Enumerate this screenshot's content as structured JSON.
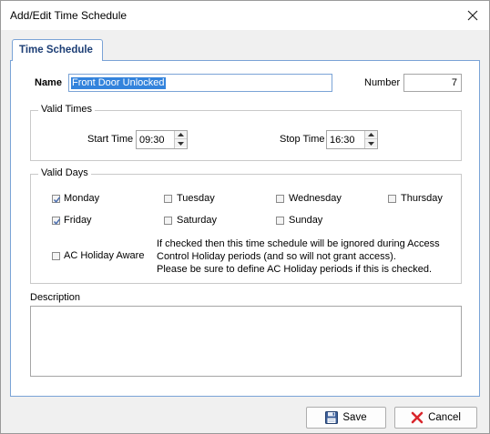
{
  "window": {
    "title": "Add/Edit Time Schedule"
  },
  "tab": {
    "label": "Time Schedule"
  },
  "form": {
    "name_label": "Name",
    "name_value": "Front Door Unlocked",
    "number_label": "Number",
    "number_value": "7"
  },
  "valid_times": {
    "title": "Valid Times",
    "start_label": "Start Time",
    "start_value": "09:30",
    "stop_label": "Stop Time",
    "stop_value": "16:30"
  },
  "valid_days": {
    "title": "Valid Days",
    "days": [
      {
        "label": "Monday",
        "checked": true
      },
      {
        "label": "Tuesday",
        "checked": false
      },
      {
        "label": "Wednesday",
        "checked": false
      },
      {
        "label": "Thursday",
        "checked": false
      },
      {
        "label": "Friday",
        "checked": true
      },
      {
        "label": "Saturday",
        "checked": false
      },
      {
        "label": "Sunday",
        "checked": false
      }
    ],
    "holiday_label": "AC Holiday Aware",
    "holiday_checked": false,
    "holiday_help": [
      "If checked then this time schedule will be ignored during Access",
      "Control Holiday periods (and so will not grant access).",
      "Please be sure to define AC Holiday periods if this is checked."
    ]
  },
  "description": {
    "label": "Description",
    "value": ""
  },
  "buttons": {
    "save": "Save",
    "cancel": "Cancel"
  },
  "colors": {
    "accent": "#3383dc",
    "tab_text": "#1c3e75",
    "cancel_icon": "#d9262c",
    "check": "#4b6eaf"
  }
}
